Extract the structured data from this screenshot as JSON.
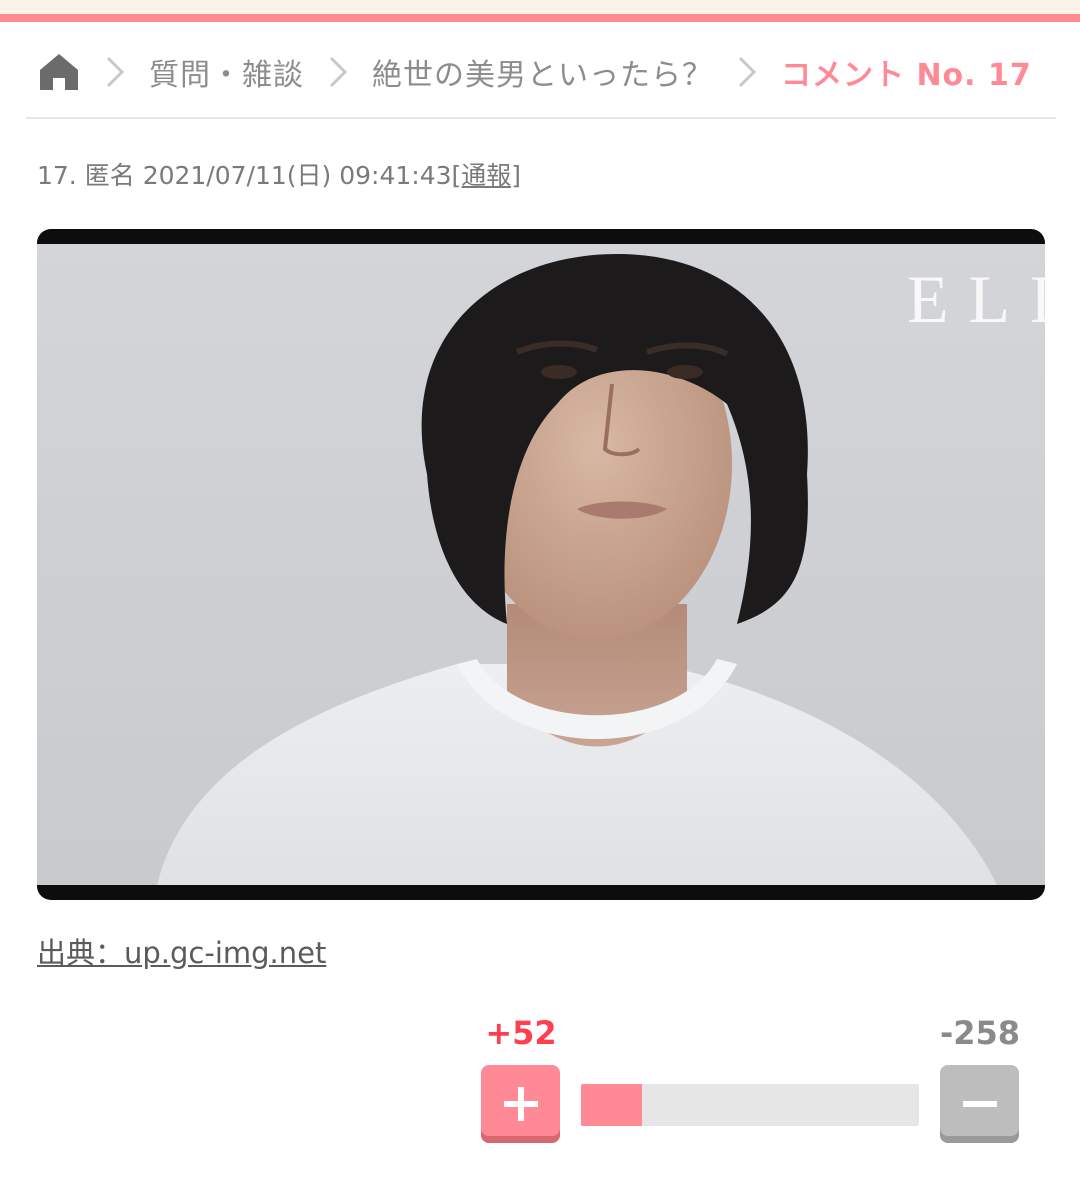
{
  "breadcrumb": {
    "home_icon": "home-icon",
    "category": "質問・雑談",
    "topic": "絶世の美男といったら？",
    "current": "コメント No. 17"
  },
  "comment": {
    "number_prefix": "17.",
    "author": "匿名",
    "datetime": "2021/07/11(日) 09:41:43",
    "report_label": "[通報]"
  },
  "image": {
    "watermark_text": "ELL"
  },
  "source": {
    "label": "出典：up.gc-img.net"
  },
  "votes": {
    "plus_label": "+52",
    "minus_label": "-258",
    "plus_ratio": 0.18
  },
  "colors": {
    "accent_pink": "#ff8a95",
    "plus_red": "#ff3f4f",
    "neutral_gray": "#bdbdbd"
  }
}
